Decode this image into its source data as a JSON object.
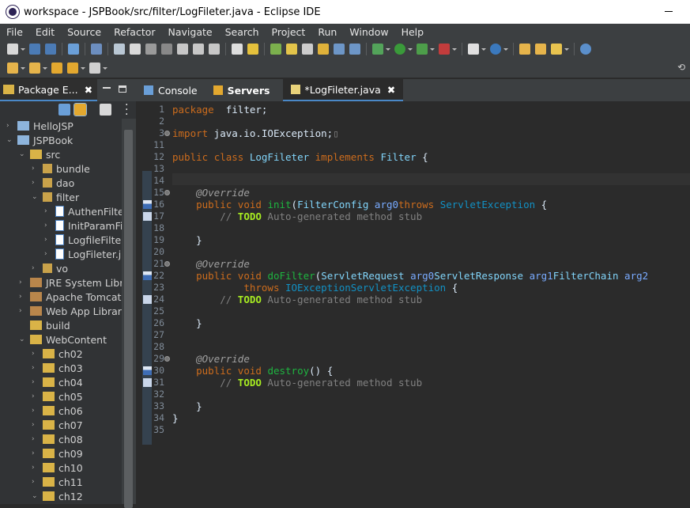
{
  "window": {
    "title": "workspace - JSPBook/src/filter/LogFileter.java - Eclipse IDE"
  },
  "menu": [
    "File",
    "Edit",
    "Source",
    "Refactor",
    "Navigate",
    "Search",
    "Project",
    "Run",
    "Window",
    "Help"
  ],
  "explorer": {
    "tab_label": "Package E...",
    "items": [
      {
        "label": "HelloJSP",
        "arrow": "›",
        "icon": "project"
      },
      {
        "label": "JSPBook",
        "arrow": "⌄",
        "icon": "project"
      },
      {
        "label": "src",
        "arrow": "⌄",
        "icon": "srcfolder"
      },
      {
        "label": "bundle",
        "arrow": "›",
        "icon": "package"
      },
      {
        "label": "dao",
        "arrow": "›",
        "icon": "package"
      },
      {
        "label": "filter",
        "arrow": "⌄",
        "icon": "package"
      },
      {
        "label": "AuthenFilter.java",
        "arrow": "›",
        "icon": "java"
      },
      {
        "label": "InitParamFilter.java",
        "arrow": "›",
        "icon": "java"
      },
      {
        "label": "LogfileFilter.java",
        "arrow": "›",
        "icon": "java"
      },
      {
        "label": "LogFileter.java",
        "arrow": "›",
        "icon": "java"
      },
      {
        "label": "vo",
        "arrow": "›",
        "icon": "package"
      },
      {
        "label": "JRE System Library",
        "arrow": "›",
        "icon": "library"
      },
      {
        "label": "Apache Tomcat v",
        "arrow": "›",
        "icon": "library"
      },
      {
        "label": "Web App Libraries",
        "arrow": "›",
        "icon": "library"
      },
      {
        "label": "build",
        "arrow": "",
        "icon": "folder"
      },
      {
        "label": "WebContent",
        "arrow": "⌄",
        "icon": "folder"
      },
      {
        "label": "ch02",
        "arrow": "›",
        "icon": "folder"
      },
      {
        "label": "ch03",
        "arrow": "›",
        "icon": "folder"
      },
      {
        "label": "ch04",
        "arrow": "›",
        "icon": "folder"
      },
      {
        "label": "ch05",
        "arrow": "›",
        "icon": "folder"
      },
      {
        "label": "ch06",
        "arrow": "›",
        "icon": "folder"
      },
      {
        "label": "ch07",
        "arrow": "›",
        "icon": "folder"
      },
      {
        "label": "ch08",
        "arrow": "›",
        "icon": "folder"
      },
      {
        "label": "ch09",
        "arrow": "›",
        "icon": "folder"
      },
      {
        "label": "ch10",
        "arrow": "›",
        "icon": "folder"
      },
      {
        "label": "ch11",
        "arrow": "›",
        "icon": "folder"
      },
      {
        "label": "ch12",
        "arrow": "⌄",
        "icon": "folder"
      }
    ]
  },
  "editor_tabs": [
    {
      "label": "Console",
      "icon": "console-icon"
    },
    {
      "label": "Servers",
      "icon": "servers-icon"
    },
    {
      "label": "*LogFileter.java",
      "icon": "java-file-icon",
      "active": true,
      "close": "✖"
    }
  ],
  "editor": {
    "lines": [
      {
        "n": "1",
        "segs": [
          [
            "k",
            "package"
          ],
          [
            "",
            "  filter;"
          ]
        ]
      },
      {
        "n": "2",
        "segs": []
      },
      {
        "n": "3",
        "fold": true,
        "segs": [
          [
            "k",
            "import"
          ],
          [
            "",
            " java.io.IOException;"
          ],
          [
            "c",
            "▯"
          ]
        ]
      },
      {
        "n": "11",
        "segs": []
      },
      {
        "n": "12",
        "segs": [
          [
            "k",
            "public"
          ],
          [
            "",
            " "
          ],
          [
            "k",
            "class"
          ],
          [
            "",
            " "
          ],
          [
            "ty",
            "LogFileter"
          ],
          [
            "",
            " "
          ],
          [
            "k",
            "implements"
          ],
          [
            "",
            " "
          ],
          [
            "ty",
            "Filter"
          ],
          [
            "",
            " {"
          ]
        ]
      },
      {
        "n": "13",
        "segs": []
      },
      {
        "n": "14",
        "segs": []
      },
      {
        "n": "15",
        "fold": true,
        "segs": [
          [
            "",
            "    "
          ],
          [
            "a",
            "@Override"
          ]
        ]
      },
      {
        "n": "16",
        "marker": "override",
        "segs": [
          [
            "",
            "    "
          ],
          [
            "k",
            "public"
          ],
          [
            "",
            " "
          ],
          [
            "k",
            "void"
          ],
          [
            "",
            " "
          ],
          [
            "m",
            "init"
          ],
          [
            "",
            "("
          ],
          [
            "ty",
            "FilterConfig"
          ],
          [
            "",
            " "
          ],
          [
            "p",
            "arg0"
          ],
          [
            ") "
          ],
          [
            "k",
            "throws"
          ],
          [
            "",
            " "
          ],
          [
            "t",
            "ServletException"
          ],
          [
            "",
            " {"
          ]
        ]
      },
      {
        "n": "17",
        "marker": "task",
        "segs": [
          [
            "",
            "        "
          ],
          [
            "c",
            "// "
          ],
          [
            "td",
            "TODO"
          ],
          [
            "c",
            " Auto-generated method stub"
          ]
        ]
      },
      {
        "n": "18",
        "segs": []
      },
      {
        "n": "19",
        "segs": [
          [
            "",
            "    }"
          ]
        ]
      },
      {
        "n": "20",
        "segs": []
      },
      {
        "n": "21",
        "fold": true,
        "segs": [
          [
            "",
            "    "
          ],
          [
            "a",
            "@Override"
          ]
        ]
      },
      {
        "n": "22",
        "marker": "override",
        "segs": [
          [
            "",
            "    "
          ],
          [
            "k",
            "public"
          ],
          [
            "",
            " "
          ],
          [
            "k",
            "void"
          ],
          [
            "",
            " "
          ],
          [
            "m",
            "doFilter"
          ],
          [
            "",
            "("
          ],
          [
            "ty",
            "ServletRequest"
          ],
          [
            "",
            " "
          ],
          [
            "p",
            "arg0"
          ],
          [
            ", "
          ],
          [
            "ty",
            "ServletResponse"
          ],
          [
            "",
            " "
          ],
          [
            "p",
            "arg1"
          ],
          [
            ", "
          ],
          [
            "ty",
            "FilterChain"
          ],
          [
            "",
            " "
          ],
          [
            "p",
            "arg2"
          ],
          [
            ")"
          ]
        ]
      },
      {
        "n": "23",
        "segs": [
          [
            "",
            "            "
          ],
          [
            "k",
            "throws"
          ],
          [
            "",
            " "
          ],
          [
            "t",
            "IOException"
          ],
          [
            ", "
          ],
          [
            "t",
            "ServletException"
          ],
          [
            "",
            " {"
          ]
        ]
      },
      {
        "n": "24",
        "marker": "task",
        "segs": [
          [
            "",
            "        "
          ],
          [
            "c",
            "// "
          ],
          [
            "td",
            "TODO"
          ],
          [
            "c",
            " Auto-generated method stub"
          ]
        ]
      },
      {
        "n": "25",
        "segs": []
      },
      {
        "n": "26",
        "segs": [
          [
            "",
            "    }"
          ]
        ]
      },
      {
        "n": "27",
        "segs": []
      },
      {
        "n": "28",
        "segs": []
      },
      {
        "n": "29",
        "fold": true,
        "segs": [
          [
            "",
            "    "
          ],
          [
            "a",
            "@Override"
          ]
        ]
      },
      {
        "n": "30",
        "marker": "override",
        "segs": [
          [
            "",
            "    "
          ],
          [
            "k",
            "public"
          ],
          [
            "",
            " "
          ],
          [
            "k",
            "void"
          ],
          [
            "",
            " "
          ],
          [
            "m",
            "destroy"
          ],
          [
            "",
            "() {"
          ]
        ]
      },
      {
        "n": "31",
        "marker": "task",
        "segs": [
          [
            "",
            "        "
          ],
          [
            "c",
            "// "
          ],
          [
            "td",
            "TODO"
          ],
          [
            "c",
            " Auto-generated method stub"
          ]
        ]
      },
      {
        "n": "32",
        "segs": []
      },
      {
        "n": "33",
        "segs": [
          [
            "",
            "    }"
          ]
        ]
      },
      {
        "n": "34",
        "segs": [
          [
            "",
            "}"
          ]
        ]
      },
      {
        "n": "35",
        "segs": []
      }
    ]
  }
}
